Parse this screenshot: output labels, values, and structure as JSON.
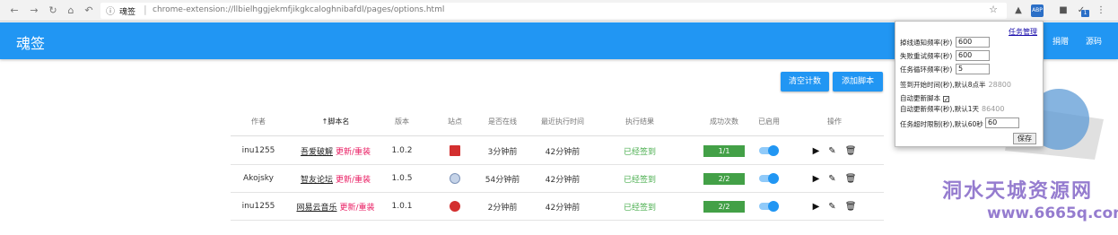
{
  "browser": {
    "tab_title": "魂签",
    "url": "chrome-extension://llbielhggjekmfjikgkcaloghnibafdl/pages/options.html",
    "ext_badge": "1"
  },
  "app": {
    "title": "魂签",
    "nav": [
      "捐赠",
      "源码"
    ],
    "accent": "#2196f3"
  },
  "toolbar": {
    "clear_label": "清空计数",
    "add_label": "添加脚本"
  },
  "table": {
    "columns": [
      "作者",
      "脚本名",
      "版本",
      "站点",
      "是否在线",
      "最近执行时间",
      "执行结果",
      "成功次数",
      "已启用",
      "操作"
    ],
    "sort_arrow": "↑",
    "update_label": "更新/重装",
    "rows": [
      {
        "author": "inu1255",
        "name": "吾爱破解",
        "version": "1.0.2",
        "site_icon": "52pojie-icon",
        "online": "3分钟前",
        "last_run": "42分钟前",
        "result": "已经签到",
        "success": "1/1"
      },
      {
        "author": "Akojsky",
        "name": "智友论坛",
        "version": "1.0.5",
        "site_icon": "zhiyou-icon",
        "online": "54分钟前",
        "last_run": "42分钟前",
        "result": "已经签到",
        "success": "2/2"
      },
      {
        "author": "inu1255",
        "name": "网易云音乐",
        "version": "1.0.1",
        "site_icon": "netease-music-icon",
        "online": "2分钟前",
        "last_run": "42分钟前",
        "result": "已经签到",
        "success": "2/2"
      }
    ]
  },
  "popup": {
    "task_manage": "任务管理",
    "fields": [
      {
        "label": "掉线通知频率(秒)",
        "value": "600"
      },
      {
        "label": "失败重试频率(秒)",
        "value": "600"
      },
      {
        "label": "任务循环频率(秒)",
        "value": "5"
      },
      {
        "label": "签到开始时间(秒),默认8点半",
        "value": "28800"
      },
      {
        "label": "自动更新脚本",
        "checked": true
      },
      {
        "label": "自动更新频率(秒),默认1天",
        "value": "86400"
      },
      {
        "label": "任务超时限制(秒),默认60秒",
        "value": "60"
      }
    ],
    "save_label": "保存"
  },
  "watermark": {
    "line1": "洞水天城资源网",
    "line2": "www.6665q.com"
  }
}
